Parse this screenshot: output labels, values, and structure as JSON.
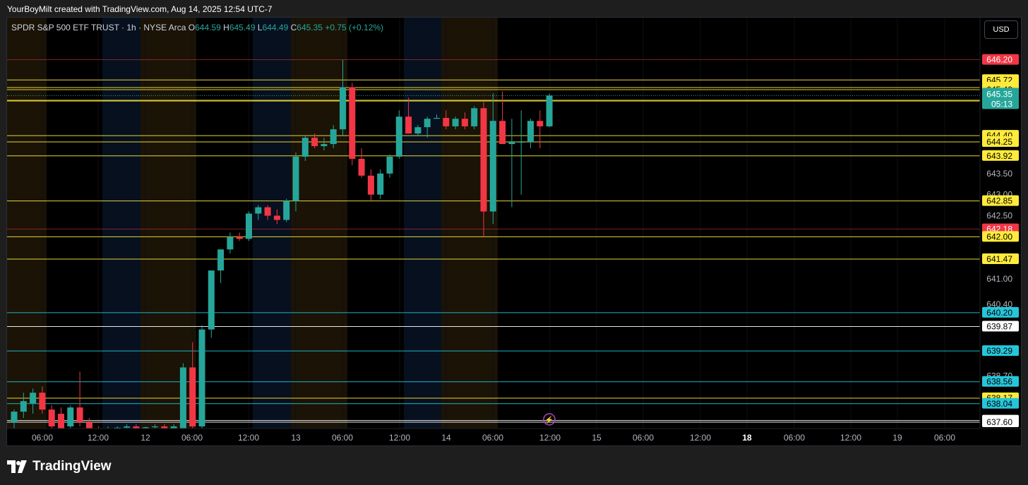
{
  "header": {
    "text": "YourBoyMilt created with TradingView.com, Aug 14, 2025 12:54 UTC-7"
  },
  "legend": {
    "title": "SPDR S&P 500 ETF TRUST · 1h · NYSE Arca",
    "o_label": "O",
    "o": "644.59",
    "h_label": "H",
    "h": "645.49",
    "l_label": "L",
    "l": "644.49",
    "c_label": "C",
    "c": "645.35",
    "change": "+0.75 (+0.12%)"
  },
  "currency_button": "USD",
  "footer": {
    "brand": "TradingView"
  },
  "colors": {
    "up": "#26a69a",
    "down": "#f23645",
    "yellow_level": "#ffeb3b",
    "cyan_level": "#26c6da",
    "white_level": "#ffffff",
    "red_level": "#f23645",
    "session_orange": "#1a1306",
    "session_blue": "#07101f"
  },
  "chart_data": {
    "type": "candlestick",
    "ylim": [
      637.4,
      646.5
    ],
    "price_axis_ticks": [
      "643.50",
      "643.00",
      "642.50",
      "641.00",
      "640.40",
      "638.70",
      "638.20"
    ],
    "time_axis_ticks": [
      "06:00",
      "12:00",
      "12",
      "06:00",
      "12:00",
      "13",
      "06:00",
      "12:00",
      "14",
      "06:00",
      "12:00",
      "15",
      "06:00",
      "12:00",
      "18",
      "06:00",
      "12:00",
      "19",
      "06:00"
    ],
    "last_price": {
      "value": "645.35",
      "countdown": "05:13"
    },
    "levels": [
      {
        "price": 646.2,
        "label": "646.20",
        "kind": "red"
      },
      {
        "price": 645.72,
        "label": "645.72",
        "kind": "yellow"
      },
      {
        "price": 645.54,
        "label": "645.54",
        "kind": "yellow"
      },
      {
        "price": 645.49,
        "label": "645.49",
        "kind": "yellow"
      },
      {
        "price": 645.24,
        "label": "645.24",
        "kind": "yellow"
      },
      {
        "price": 645.22,
        "label": "645.22",
        "kind": "yellow"
      },
      {
        "price": 644.4,
        "label": "644.40",
        "kind": "yellow"
      },
      {
        "price": 644.25,
        "label": "644.25",
        "kind": "yellow"
      },
      {
        "price": 643.92,
        "label": "643.92",
        "kind": "yellow"
      },
      {
        "price": 642.85,
        "label": "642.85",
        "kind": "yellow"
      },
      {
        "price": 642.18,
        "label": "642.18",
        "kind": "red"
      },
      {
        "price": 642.0,
        "label": "642.00",
        "kind": "yellow"
      },
      {
        "price": 641.47,
        "label": "641.47",
        "kind": "yellow"
      },
      {
        "price": 640.2,
        "label": "640.20",
        "kind": "cyan"
      },
      {
        "price": 639.87,
        "label": "639.87",
        "kind": "white"
      },
      {
        "price": 639.29,
        "label": "639.29",
        "kind": "cyan"
      },
      {
        "price": 638.56,
        "label": "638.56",
        "kind": "cyan"
      },
      {
        "price": 638.17,
        "label": "638.17",
        "kind": "yellow"
      },
      {
        "price": 638.04,
        "label": "638.04",
        "kind": "cyan"
      },
      {
        "price": 637.64,
        "label": "637.64",
        "kind": "white"
      },
      {
        "price": 637.6,
        "label": "637.60",
        "kind": "white"
      }
    ],
    "candles": [
      {
        "o": 637.6,
        "h": 637.9,
        "l": 637.4,
        "c": 637.85
      },
      {
        "o": 637.85,
        "h": 638.3,
        "l": 637.7,
        "c": 638.1
      },
      {
        "o": 638.05,
        "h": 638.4,
        "l": 637.8,
        "c": 638.3
      },
      {
        "o": 638.3,
        "h": 638.45,
        "l": 637.8,
        "c": 637.9
      },
      {
        "o": 637.9,
        "h": 638.0,
        "l": 637.4,
        "c": 637.5
      },
      {
        "o": 637.8,
        "h": 637.95,
        "l": 637.4,
        "c": 637.45
      },
      {
        "o": 637.5,
        "h": 638.0,
        "l": 637.4,
        "c": 637.95
      },
      {
        "o": 637.95,
        "h": 638.8,
        "l": 637.5,
        "c": 637.6
      },
      {
        "o": 637.6,
        "h": 637.7,
        "l": 637.4,
        "c": 637.45
      },
      {
        "o": 637.45,
        "h": 637.5,
        "l": 637.4,
        "c": 637.42
      },
      {
        "o": 637.42,
        "h": 637.5,
        "l": 637.4,
        "c": 637.45
      },
      {
        "o": 637.45,
        "h": 637.5,
        "l": 637.4,
        "c": 637.47
      },
      {
        "o": 637.47,
        "h": 637.55,
        "l": 637.4,
        "c": 637.5
      },
      {
        "o": 637.5,
        "h": 637.55,
        "l": 637.4,
        "c": 637.45
      },
      {
        "o": 637.45,
        "h": 637.5,
        "l": 637.4,
        "c": 637.48
      },
      {
        "o": 637.48,
        "h": 637.55,
        "l": 637.4,
        "c": 637.5
      },
      {
        "o": 637.5,
        "h": 637.55,
        "l": 637.4,
        "c": 637.45
      },
      {
        "o": 637.45,
        "h": 637.55,
        "l": 637.4,
        "c": 637.5
      },
      {
        "o": 637.4,
        "h": 639.0,
        "l": 637.4,
        "c": 638.9
      },
      {
        "o": 638.9,
        "h": 639.5,
        "l": 637.4,
        "c": 637.5
      },
      {
        "o": 637.5,
        "h": 639.9,
        "l": 637.4,
        "c": 639.8
      },
      {
        "o": 639.8,
        "h": 640.5,
        "l": 639.6,
        "c": 641.2
      },
      {
        "o": 641.2,
        "h": 641.7,
        "l": 640.9,
        "c": 641.7
      },
      {
        "o": 641.7,
        "h": 642.1,
        "l": 641.6,
        "c": 642.0
      },
      {
        "o": 642.0,
        "h": 642.1,
        "l": 641.9,
        "c": 641.95
      },
      {
        "o": 641.95,
        "h": 642.6,
        "l": 641.9,
        "c": 642.55
      },
      {
        "o": 642.55,
        "h": 642.75,
        "l": 642.4,
        "c": 642.7
      },
      {
        "o": 642.7,
        "h": 642.75,
        "l": 642.4,
        "c": 642.5
      },
      {
        "o": 642.5,
        "h": 642.65,
        "l": 642.3,
        "c": 642.4
      },
      {
        "o": 642.4,
        "h": 642.9,
        "l": 642.35,
        "c": 642.85
      },
      {
        "o": 642.85,
        "h": 644.0,
        "l": 642.6,
        "c": 643.9
      },
      {
        "o": 643.9,
        "h": 644.4,
        "l": 643.8,
        "c": 644.35
      },
      {
        "o": 644.35,
        "h": 644.45,
        "l": 644.1,
        "c": 644.15
      },
      {
        "o": 644.15,
        "h": 644.35,
        "l": 644.05,
        "c": 644.2
      },
      {
        "o": 644.2,
        "h": 644.65,
        "l": 644.1,
        "c": 644.55
      },
      {
        "o": 644.55,
        "h": 646.2,
        "l": 644.4,
        "c": 645.55
      },
      {
        "o": 645.55,
        "h": 645.65,
        "l": 643.7,
        "c": 643.85
      },
      {
        "o": 643.85,
        "h": 644.1,
        "l": 643.4,
        "c": 643.45
      },
      {
        "o": 643.45,
        "h": 643.6,
        "l": 642.85,
        "c": 643.0
      },
      {
        "o": 643.0,
        "h": 643.6,
        "l": 642.9,
        "c": 643.5
      },
      {
        "o": 643.5,
        "h": 643.95,
        "l": 643.4,
        "c": 643.9
      },
      {
        "o": 643.9,
        "h": 645.0,
        "l": 643.85,
        "c": 644.85
      },
      {
        "o": 644.85,
        "h": 645.3,
        "l": 644.45,
        "c": 644.45
      },
      {
        "o": 644.45,
        "h": 644.65,
        "l": 644.4,
        "c": 644.6
      },
      {
        "o": 644.6,
        "h": 644.85,
        "l": 644.35,
        "c": 644.8
      },
      {
        "o": 644.8,
        "h": 644.9,
        "l": 644.8,
        "c": 644.82
      },
      {
        "o": 644.82,
        "h": 645.0,
        "l": 644.55,
        "c": 644.62
      },
      {
        "o": 644.62,
        "h": 644.85,
        "l": 644.55,
        "c": 644.8
      },
      {
        "o": 644.8,
        "h": 644.95,
        "l": 644.55,
        "c": 644.62
      },
      {
        "o": 644.62,
        "h": 645.1,
        "l": 644.55,
        "c": 645.05
      },
      {
        "o": 645.05,
        "h": 645.2,
        "l": 642.0,
        "c": 642.6
      },
      {
        "o": 642.6,
        "h": 645.4,
        "l": 642.3,
        "c": 644.75
      },
      {
        "o": 644.75,
        "h": 645.45,
        "l": 644.2,
        "c": 644.2
      },
      {
        "o": 644.2,
        "h": 644.8,
        "l": 642.7,
        "c": 644.25
      },
      {
        "o": 644.25,
        "h": 645.0,
        "l": 643.0,
        "c": 644.25
      },
      {
        "o": 644.25,
        "h": 644.8,
        "l": 644.1,
        "c": 644.75
      },
      {
        "o": 644.75,
        "h": 645.0,
        "l": 644.1,
        "c": 644.62
      },
      {
        "o": 644.62,
        "h": 645.4,
        "l": 644.6,
        "c": 645.35
      }
    ]
  }
}
